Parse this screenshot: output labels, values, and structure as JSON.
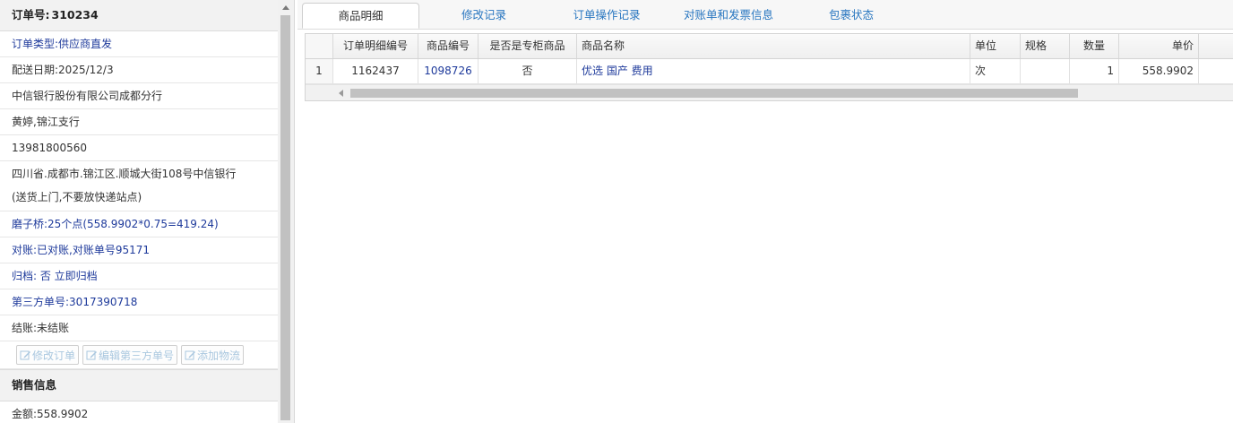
{
  "order": {
    "number_label": "订单号:",
    "number_value": "310234"
  },
  "info_rows": [
    {
      "text": "订单类型:供应商直发",
      "color": "blue"
    },
    {
      "text": "配送日期:2025/12/3",
      "color": "normal"
    },
    {
      "text": "中信银行股份有限公司成都分行",
      "color": "normal"
    },
    {
      "text": "黄婷,锦江支行",
      "color": "normal"
    },
    {
      "text": "13981800560",
      "color": "normal"
    }
  ],
  "address": {
    "line1": "四川省.成都市.锦江区.顺城大街108号中信银行",
    "line2": "(送货上门,不要放快递站点)"
  },
  "status_rows": [
    {
      "text": "磨子桥:25个点(558.9902*0.75=419.24)"
    },
    {
      "text": "对账:已对账,对账单号95171"
    },
    {
      "text": "归档: 否 立即归档"
    },
    {
      "text": "第三方单号:3017390718"
    },
    {
      "text": "结账:未结账"
    }
  ],
  "buttons": {
    "edit_order": "修改订单",
    "edit_third_party": "编辑第三方单号",
    "add_logistics": "添加物流"
  },
  "sales": {
    "title": "销售信息",
    "amount": "金额:558.9902"
  },
  "tabs": [
    {
      "label": "商品明细",
      "active": true
    },
    {
      "label": "修改记录",
      "active": false
    },
    {
      "label": "订单操作记录",
      "active": false
    },
    {
      "label": "对账单和发票信息",
      "active": false
    },
    {
      "label": "包裹状态",
      "active": false
    }
  ],
  "grid": {
    "headers": [
      "",
      "订单明细编号",
      "商品编号",
      "是否是专柜商品",
      "商品名称",
      "单位",
      "规格",
      "数量",
      "单价"
    ],
    "rows": [
      [
        "1",
        "1162437",
        "1098726",
        "否",
        "优选 国产 费用",
        "次",
        "",
        "1",
        "558.9902"
      ]
    ]
  },
  "colors": {
    "link_blue": "#1e3a9b",
    "tab_blue": "#2876c0",
    "header_bg": "#f2f2f2"
  }
}
